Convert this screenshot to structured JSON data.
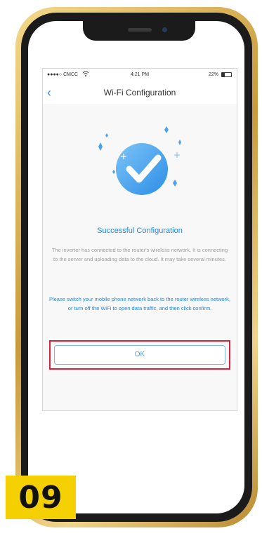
{
  "status_bar": {
    "carrier": "●●●●○ CMCC",
    "time": "4:21 PM",
    "battery": "22%"
  },
  "nav": {
    "back_icon": "‹",
    "title": "Wi-Fi Configuration"
  },
  "result": {
    "title": "Successful Configuration",
    "description": "The inverter has connected to the router's wireless network. It is connecting to the server and uploading data to the cloud. It may take several minutes.",
    "instruction": "Please switch your mobile phone network back to the router wireless network, or turn off the WiFi to open data traffic, and then click confirm."
  },
  "ok_button": {
    "label": "OK"
  },
  "step_badge": {
    "label": "09"
  },
  "colors": {
    "accent": "#1e88e5",
    "highlight": "#d8233a",
    "badge": "#f5d000",
    "phone_frame": "#d4a94a"
  },
  "icons": {
    "back": "chevron-left-icon",
    "wifi": "wifi-icon",
    "battery": "battery-icon",
    "success": "check-circle-icon"
  }
}
